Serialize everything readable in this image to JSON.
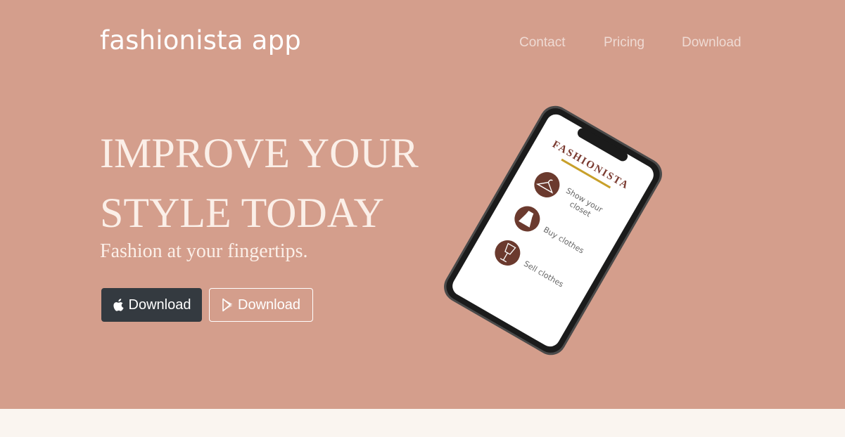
{
  "brand": {
    "name": "fashionista app"
  },
  "nav": {
    "items": [
      {
        "label": "Contact"
      },
      {
        "label": "Pricing"
      },
      {
        "label": "Download"
      }
    ]
  },
  "hero": {
    "headline_line1": "IMPROVE YOUR",
    "headline_line2": "STYLE TODAY",
    "subtitle": "Fashion at your fingertips.",
    "buttons": [
      {
        "label": "Download",
        "icon": "apple-icon"
      },
      {
        "label": "Download",
        "icon": "google-play-icon"
      }
    ]
  },
  "phone_screen": {
    "logo": "FASHIONISTA",
    "items": [
      {
        "line1": "Show your",
        "line2": "closet",
        "icon": "hanger-icon"
      },
      {
        "line1": "Buy clothes",
        "line2": "",
        "icon": "dress-icon"
      },
      {
        "line1": "Sell clothes",
        "line2": "",
        "icon": "mannequin-icon"
      }
    ]
  },
  "colors": {
    "hero_bg": "#d49e8c",
    "page_bg": "#faf5f0",
    "dark_button": "#343a40",
    "icon_circle": "#6b3a2e",
    "logo_underline": "#c8a02a"
  }
}
